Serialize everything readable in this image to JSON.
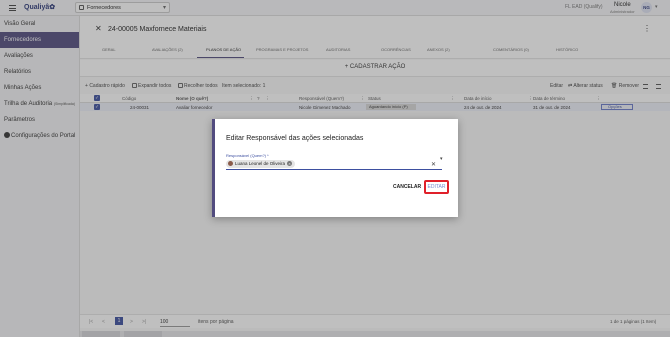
{
  "topbar": {
    "brand": "Qualiyâ",
    "brand_mark": "✿",
    "module": "Fornecedores",
    "company": "FL EAD (Qualify)",
    "user_name": "Nicole",
    "user_role": "Administrador",
    "user_initials": "NG"
  },
  "sidebar": {
    "items": [
      {
        "label": "Visão Geral"
      },
      {
        "label": "Fornecedores"
      },
      {
        "label": "Avaliações"
      },
      {
        "label": "Relatórios"
      },
      {
        "label": "Minhas Ações"
      },
      {
        "label": "Trilha de Auditoria",
        "tag": "(Simplificada)"
      },
      {
        "label": "Parâmetros"
      },
      {
        "label": "Configurações do Portal"
      }
    ]
  },
  "page": {
    "title": "24-00005 Maxfornece Materiais",
    "tabs": [
      "Geral",
      "Avaliações (2)",
      "Planos de ação",
      "Programas e projetos",
      "Auditorias",
      "Ocorrências",
      "Anexos (2)",
      "Comentários (0)",
      "Histórico"
    ],
    "add_action": "+ CADASTRAR AÇÃO"
  },
  "toolbar": {
    "quick_register": "Cadastro rápido",
    "expand_all": "Expandir todos",
    "collapse_all": "Recolher todos",
    "selected": "Item selecionado: 1",
    "edit": "Editar",
    "change_status": "Alterar status",
    "remove": "Remover"
  },
  "table": {
    "headers": [
      "Código",
      "Nome (O quê?)",
      "Responsável (Quem?)",
      "Status",
      "Data de início",
      "Data de término"
    ],
    "rows": [
      {
        "code": "24-00031",
        "name": "Avaliar fornecedor",
        "responsible": "Nicole Gimenez Machado",
        "status": "Aguardando início (P)",
        "start": "24 de out. de 2024",
        "end": "31 de out. de 2024",
        "options": "Opções"
      }
    ]
  },
  "footer": {
    "page_first": "|<",
    "page_prev": "<",
    "page": "1",
    "page_next": ">",
    "page_last": ">|",
    "page_size": "100",
    "per_page": "itens por página",
    "info": "1 de 1 páginas (1 Item)"
  },
  "dialog": {
    "title": "Editar Responsável das ações selecionadas",
    "field_label": "Responsável (Quem?) *",
    "chip_value": "Luana Leonel de Oliveira",
    "cancel": "CANCELAR",
    "edit": "EDITAR"
  },
  "colors": {
    "accent": "#524c7f",
    "primary": "#3d4fa0",
    "highlight": "#e0202a"
  }
}
